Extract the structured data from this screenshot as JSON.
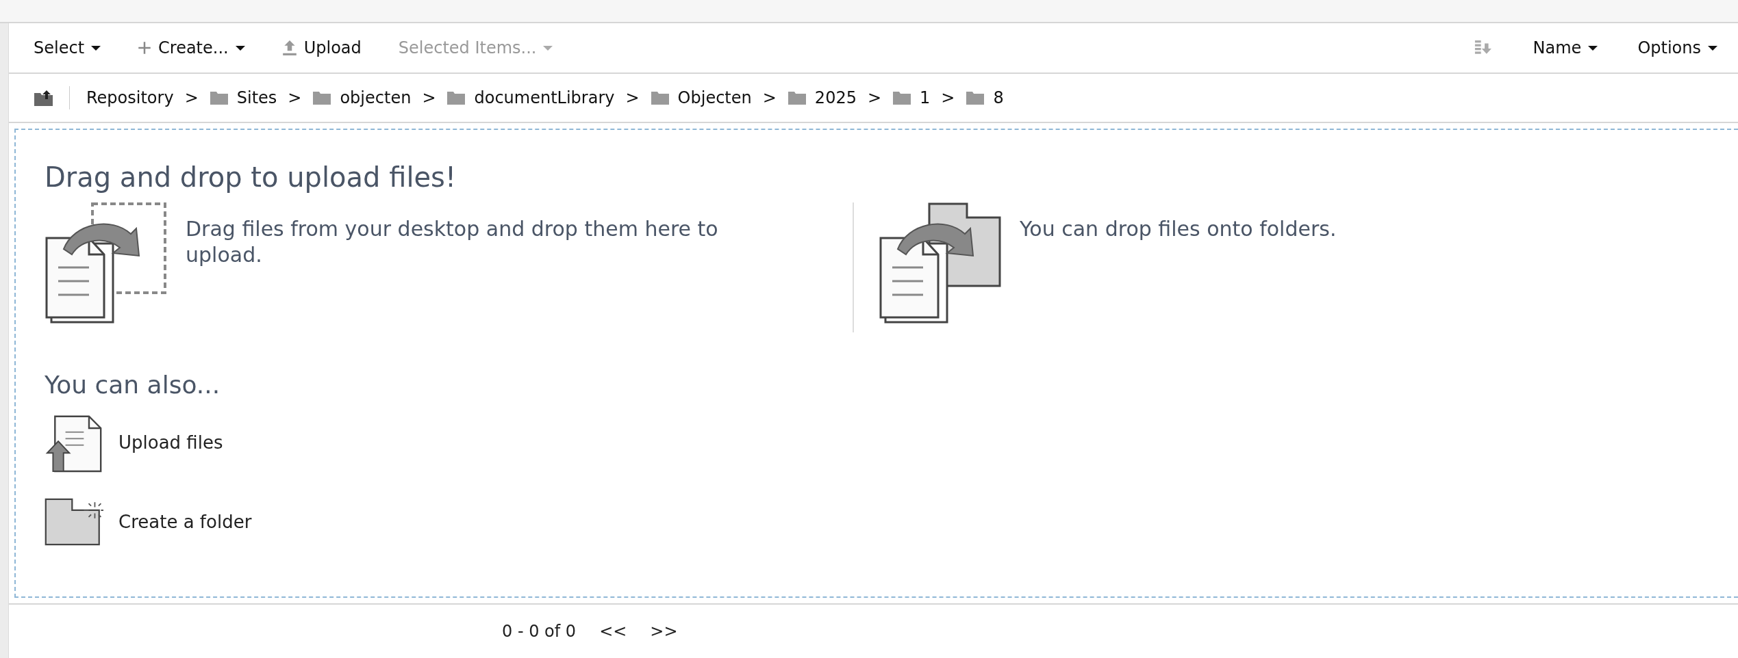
{
  "toolbar": {
    "actions": [
      {
        "label": "Select",
        "kind": "menu",
        "disabled": false
      },
      {
        "label": "Create...",
        "kind": "add-menu",
        "disabled": false
      },
      {
        "label": "Upload",
        "kind": "upload",
        "disabled": false
      },
      {
        "label": "Selected Items...",
        "kind": "menu",
        "disabled": true
      }
    ],
    "sort": {
      "label": "Name"
    },
    "options": {
      "label": "Options"
    }
  },
  "breadcrumb": {
    "items": [
      {
        "label": "Repository",
        "kind": "root"
      },
      {
        "label": "Sites",
        "kind": "folder"
      },
      {
        "label": "objecten",
        "kind": "folder"
      },
      {
        "label": "documentLibrary",
        "kind": "folder"
      },
      {
        "label": "Objecten",
        "kind": "folder"
      },
      {
        "label": "2025",
        "kind": "folder"
      },
      {
        "label": "1",
        "kind": "folder"
      },
      {
        "label": "8",
        "kind": "folder"
      }
    ],
    "separators": [
      ">",
      ">",
      ">",
      ">",
      ">",
      ">",
      ">"
    ]
  },
  "drop_zone": {
    "title": "Drag and drop to upload files!",
    "hints": [
      {
        "kind": "desktop",
        "text": "Drag files from your desktop and drop them here to upload."
      },
      {
        "kind": "folder",
        "text": "You can drop files onto folders."
      }
    ],
    "also_title": "You can also...",
    "also_actions": [
      {
        "kind": "upload",
        "label": "Upload files"
      },
      {
        "kind": "folder",
        "label": "Create a folder"
      }
    ]
  },
  "pagination": {
    "range": "0 - 0 of 0",
    "previous": "<<",
    "next": ">>"
  }
}
